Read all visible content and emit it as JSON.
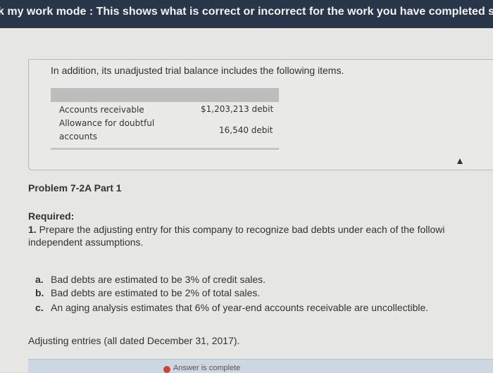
{
  "banner": {
    "text": "k my work mode : This shows what is correct or incorrect for the work you have completed so far"
  },
  "intro": "In addition, its unadjusted trial balance includes the following items.",
  "trial_balance": {
    "rows": [
      {
        "name": "Accounts receivable",
        "amount": "$1,203,213 debit"
      },
      {
        "name": "Allowance for doubtful accounts",
        "amount": "16,540 debit"
      }
    ]
  },
  "problem": {
    "title": "Problem 7-2A Part 1",
    "required_label": "Required:",
    "required_number": "1.",
    "required_text": "Prepare the adjusting entry for this company to recognize bad debts under each of the followi",
    "required_text_2": "independent assumptions.",
    "assumptions": [
      {
        "letter": "a.",
        "text": "Bad debts are estimated to be 3% of credit sales."
      },
      {
        "letter": "b.",
        "text": "Bad debts are estimated to be 2% of total sales."
      },
      {
        "letter": "c.",
        "text": "An aging analysis estimates that 6% of year-end accounts receivable are uncollectible."
      }
    ],
    "adjusting_heading": "Adjusting entries (all dated December 31, 2017)."
  },
  "footer": {
    "answer_status": "Answer is complete"
  },
  "colors": {
    "banner_bg": "#29364a",
    "status_icon": "#d0413a"
  },
  "icons": {
    "cursor": "mouse-cursor-icon",
    "status": "answer-status-icon"
  }
}
